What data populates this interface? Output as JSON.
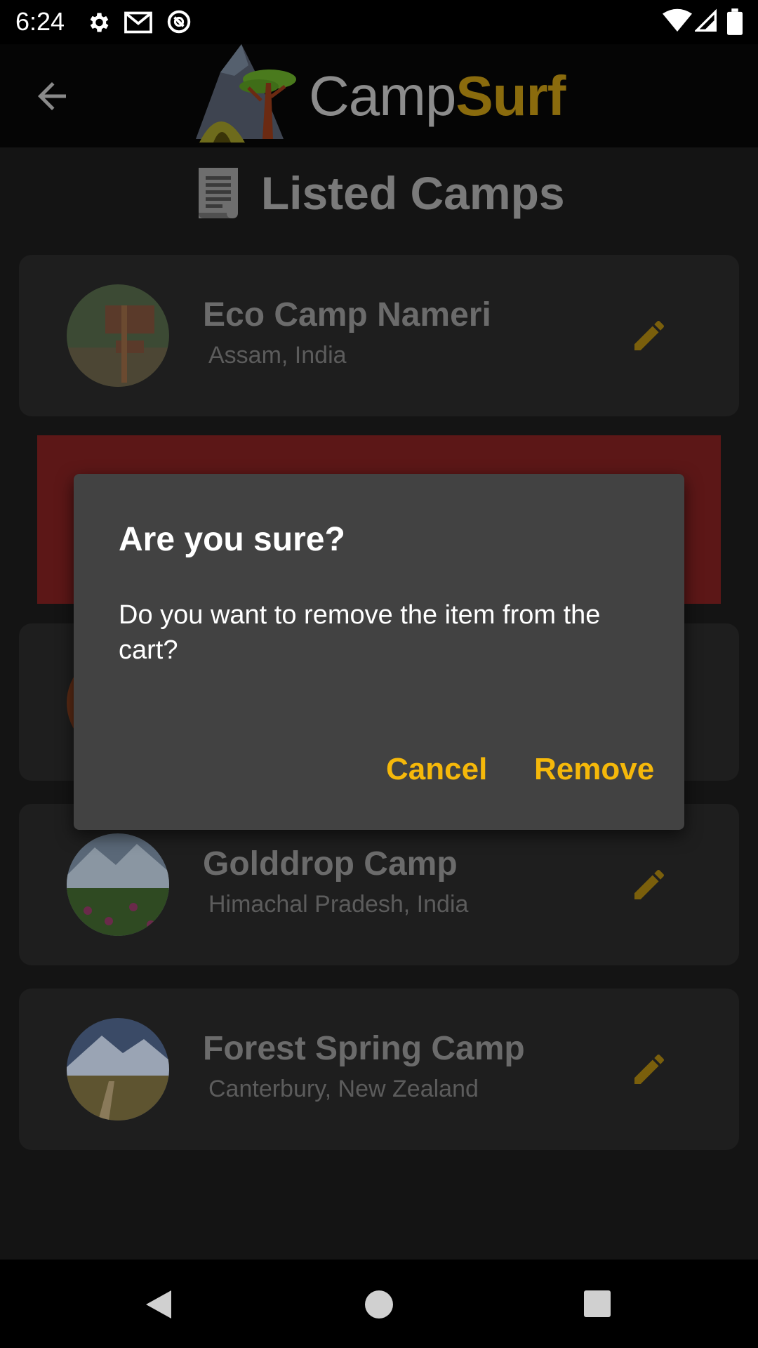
{
  "status_bar": {
    "time": "6:24",
    "icons": [
      "settings-icon",
      "gmail-icon",
      "sync-icon",
      "wifi-icon",
      "signal-icon",
      "battery-icon"
    ]
  },
  "app_bar": {
    "back_icon": "arrow-back-icon",
    "title_part1": "Camp",
    "title_part2": "Surf",
    "colors": {
      "title_gray": "#8c8c8c",
      "title_gold": "#8a6b0d"
    }
  },
  "page": {
    "title": "Listed Camps",
    "title_icon": "document-icon"
  },
  "camps": [
    {
      "name": "Eco Camp Nameri",
      "location": "Assam,  India"
    },
    {
      "name": "Golddrop Camp",
      "location": "Himachal Pradesh,  India"
    },
    {
      "name": "Forest Spring Camp",
      "location": "Canterbury,  New Zealand"
    }
  ],
  "dialog": {
    "title": "Are you sure?",
    "message": "Do you want to remove the item from the cart?",
    "cancel_label": "Cancel",
    "confirm_label": "Remove",
    "accent": "#f5b80a"
  },
  "nav_bar": {
    "icons": [
      "back-triangle-icon",
      "home-circle-icon",
      "recents-square-icon"
    ]
  }
}
